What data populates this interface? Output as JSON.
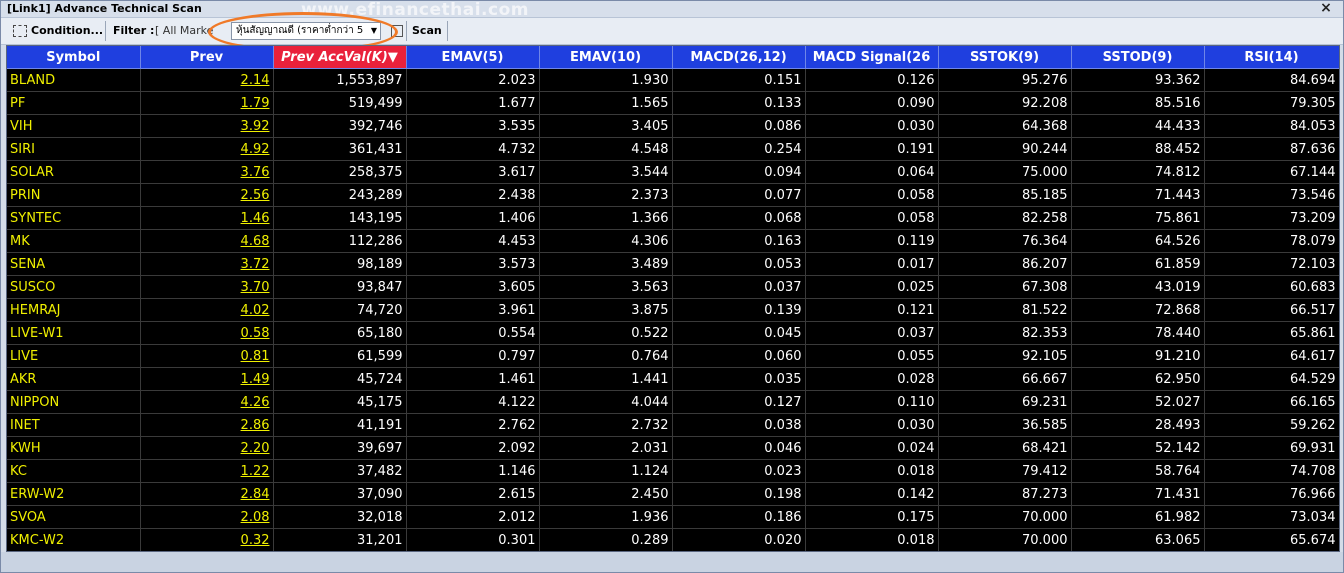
{
  "window": {
    "title": "[Link1] Advance Technical Scan",
    "close_glyph": "×",
    "watermark": "www.efinancethai.com"
  },
  "toolbar": {
    "condition_label": "Condition...",
    "condition_icon": "condition-icon",
    "filter_label": "Filter :",
    "filter_value": "[ All Marke",
    "select_value": "หุ้นสัญญาณดี (ราคาต่ำกว่า 5",
    "select_arrow": "▼",
    "scan_label": "Scan",
    "highlight_color": "#f07a28"
  },
  "table": {
    "header_color": "#1f3fdf",
    "sorted_color": "#e9213b",
    "symbol_color": "#f0f000",
    "columns": [
      "Symbol",
      "Prev",
      "Prev AccVal(K)▼",
      "EMAV(5)",
      "EMAV(10)",
      "MACD(26,12)",
      "MACD Signal(26",
      "SSTOK(9)",
      "SSTOD(9)",
      "RSI(14)"
    ],
    "sorted_column": 2,
    "rows": [
      [
        "BLAND",
        "2.14",
        "1,553,897",
        "2.023",
        "1.930",
        "0.151",
        "0.126",
        "95.276",
        "93.362",
        "84.694"
      ],
      [
        "PF",
        "1.79",
        "519,499",
        "1.677",
        "1.565",
        "0.133",
        "0.090",
        "92.208",
        "85.516",
        "79.305"
      ],
      [
        "VIH",
        "3.92",
        "392,746",
        "3.535",
        "3.405",
        "0.086",
        "0.030",
        "64.368",
        "44.433",
        "84.053"
      ],
      [
        "SIRI",
        "4.92",
        "361,431",
        "4.732",
        "4.548",
        "0.254",
        "0.191",
        "90.244",
        "88.452",
        "87.636"
      ],
      [
        "SOLAR",
        "3.76",
        "258,375",
        "3.617",
        "3.544",
        "0.094",
        "0.064",
        "75.000",
        "74.812",
        "67.144"
      ],
      [
        "PRIN",
        "2.56",
        "243,289",
        "2.438",
        "2.373",
        "0.077",
        "0.058",
        "85.185",
        "71.443",
        "73.546"
      ],
      [
        "SYNTEC",
        "1.46",
        "143,195",
        "1.406",
        "1.366",
        "0.068",
        "0.058",
        "82.258",
        "75.861",
        "73.209"
      ],
      [
        "MK",
        "4.68",
        "112,286",
        "4.453",
        "4.306",
        "0.163",
        "0.119",
        "76.364",
        "64.526",
        "78.079"
      ],
      [
        "SENA",
        "3.72",
        "98,189",
        "3.573",
        "3.489",
        "0.053",
        "0.017",
        "86.207",
        "61.859",
        "72.103"
      ],
      [
        "SUSCO",
        "3.70",
        "93,847",
        "3.605",
        "3.563",
        "0.037",
        "0.025",
        "67.308",
        "43.019",
        "60.683"
      ],
      [
        "HEMRAJ",
        "4.02",
        "74,720",
        "3.961",
        "3.875",
        "0.139",
        "0.121",
        "81.522",
        "72.868",
        "66.517"
      ],
      [
        "LIVE-W1",
        "0.58",
        "65,180",
        "0.554",
        "0.522",
        "0.045",
        "0.037",
        "82.353",
        "78.440",
        "65.861"
      ],
      [
        "LIVE",
        "0.81",
        "61,599",
        "0.797",
        "0.764",
        "0.060",
        "0.055",
        "92.105",
        "91.210",
        "64.617"
      ],
      [
        "AKR",
        "1.49",
        "45,724",
        "1.461",
        "1.441",
        "0.035",
        "0.028",
        "66.667",
        "62.950",
        "64.529"
      ],
      [
        "NIPPON",
        "4.26",
        "45,175",
        "4.122",
        "4.044",
        "0.127",
        "0.110",
        "69.231",
        "52.027",
        "66.165"
      ],
      [
        "INET",
        "2.86",
        "41,191",
        "2.762",
        "2.732",
        "0.038",
        "0.030",
        "36.585",
        "28.493",
        "59.262"
      ],
      [
        "KWH",
        "2.20",
        "39,697",
        "2.092",
        "2.031",
        "0.046",
        "0.024",
        "68.421",
        "52.142",
        "69.931"
      ],
      [
        "KC",
        "1.22",
        "37,482",
        "1.146",
        "1.124",
        "0.023",
        "0.018",
        "79.412",
        "58.764",
        "74.708"
      ],
      [
        "ERW-W2",
        "2.84",
        "37,090",
        "2.615",
        "2.450",
        "0.198",
        "0.142",
        "87.273",
        "71.431",
        "76.966"
      ],
      [
        "SVOA",
        "2.08",
        "32,018",
        "2.012",
        "1.936",
        "0.186",
        "0.175",
        "70.000",
        "61.982",
        "73.034"
      ],
      [
        "KMC-W2",
        "0.32",
        "31,201",
        "0.301",
        "0.289",
        "0.020",
        "0.018",
        "70.000",
        "63.065",
        "65.674"
      ]
    ]
  }
}
